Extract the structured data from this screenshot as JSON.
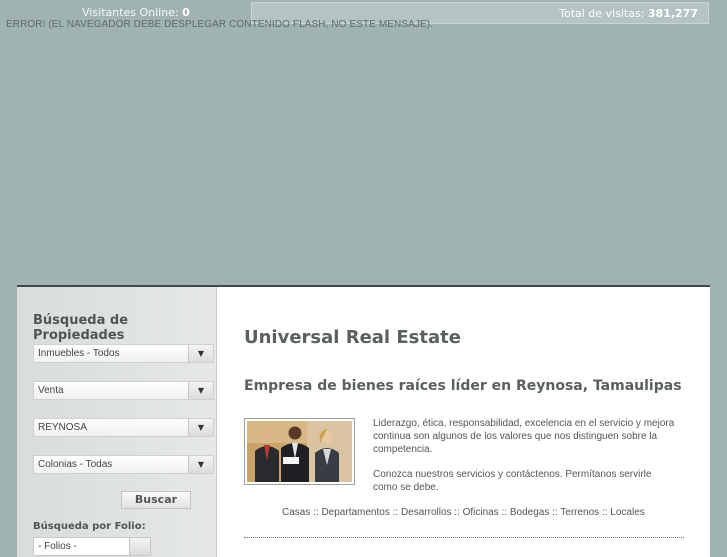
{
  "topbar": {
    "visitors_label": "Visitantes Online:",
    "visitors_count": "0",
    "visits_label": "Total de visitas:",
    "visits_count": "381,277"
  },
  "flash_error": "ERROR! (EL NAVEGADOR DEBE DESPLEGAR CONTENIDO FLASH, NO ESTE MENSAJE).",
  "sidebar": {
    "title": "Búsqueda de Propiedades",
    "selects": [
      {
        "value": "Inmuebles - Todos"
      },
      {
        "value": "Venta"
      },
      {
        "value": "REYNOSA"
      },
      {
        "value": "Colonias - Todas"
      }
    ],
    "search_button": "Buscar",
    "folio_label": "Búsqueda por Folio:",
    "folio_select": "- Folios -"
  },
  "content": {
    "title": "Universal Real Estate",
    "subtitle": "Empresa de bienes raíces líder en Reynosa, Tamaulipas",
    "paragraphs": [
      "Liderazgo, ética, responsabilidad, excelencia en el servicio y mejora continua son algunos de los valores que nos distinguen sobre la competencia.",
      "Conozca nuestros servicios y contáctenos. Permítanos servirle como se debe."
    ],
    "categories": "Casas :: Departamentos :: Desarrollos :: Oficinas :: Bodegas :: Terrenos :: Locales"
  },
  "colors": {
    "page_background": "#a0b3b1",
    "main_border": "#3c4a49",
    "heading_text": "#5a5f5f"
  },
  "icons": {
    "select_arrow": "chevron-down-icon"
  }
}
